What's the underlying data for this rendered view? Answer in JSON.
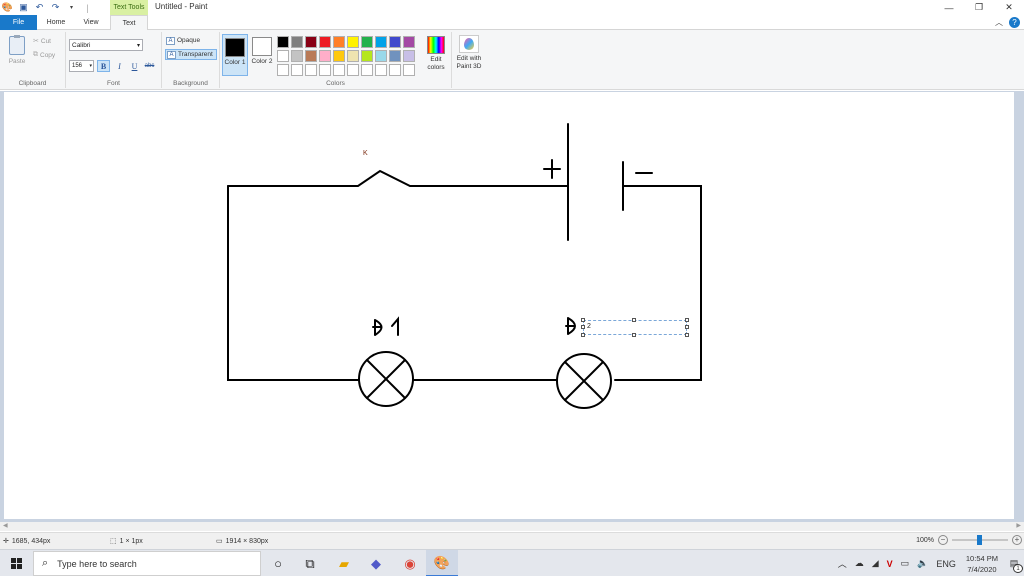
{
  "window": {
    "title": "Untitled - Paint",
    "context_tab": "Text Tools",
    "controls": {
      "minimize": "—",
      "maximize": "❐",
      "close": "✕"
    }
  },
  "tabs": {
    "file": "File",
    "home": "Home",
    "view": "View",
    "text": "Text"
  },
  "ribbon": {
    "clipboard": {
      "paste": "Paste",
      "cut": "Cut",
      "copy": "Copy",
      "label": "Clipboard"
    },
    "font": {
      "family": "Calibri",
      "size": "156",
      "bold": "B",
      "italic": "I",
      "underline": "U",
      "strikethrough": "abc",
      "label": "Font"
    },
    "background": {
      "opaque": "Opaque",
      "transparent": "Transparent",
      "label": "Background"
    },
    "colors": {
      "color1_label": "Color 1",
      "color2_label": "Color 2",
      "color1_value": "#000000",
      "color2_value": "#ffffff",
      "edit_colors": "Edit colors",
      "label": "Colors",
      "palette": [
        "#000000",
        "#7f7f7f",
        "#880015",
        "#ed1c24",
        "#ff7f27",
        "#fff200",
        "#22b14c",
        "#00a2e8",
        "#3f48cc",
        "#a349a4",
        "#ffffff",
        "#c3c3c3",
        "#b97a57",
        "#ffaec9",
        "#ffc90e",
        "#efe4b0",
        "#b5e61d",
        "#99d9ea",
        "#7092be",
        "#c8bfe7",
        "#ffffff",
        "#ffffff",
        "#ffffff",
        "#ffffff",
        "#ffffff",
        "#ffffff",
        "#ffffff",
        "#ffffff",
        "#ffffff",
        "#ffffff"
      ]
    },
    "paint3d": "Edit with Paint 3D"
  },
  "canvas": {
    "switch_label": "K",
    "plus_sign": "+",
    "minus_sign": "−",
    "lamp1_label": "Đ1",
    "lamp2_label_prefix": "Đ",
    "text_box_value": "2"
  },
  "status": {
    "cursor_pos": "1685, 434px",
    "selection_size": "1 × 1px",
    "canvas_size": "1914 × 830px",
    "zoom": "100%"
  },
  "taskbar": {
    "search_placeholder": "Type here to search",
    "lang": "ENG",
    "time": "10:54 PM",
    "date": "7/4/2020",
    "notification_count": "1"
  }
}
